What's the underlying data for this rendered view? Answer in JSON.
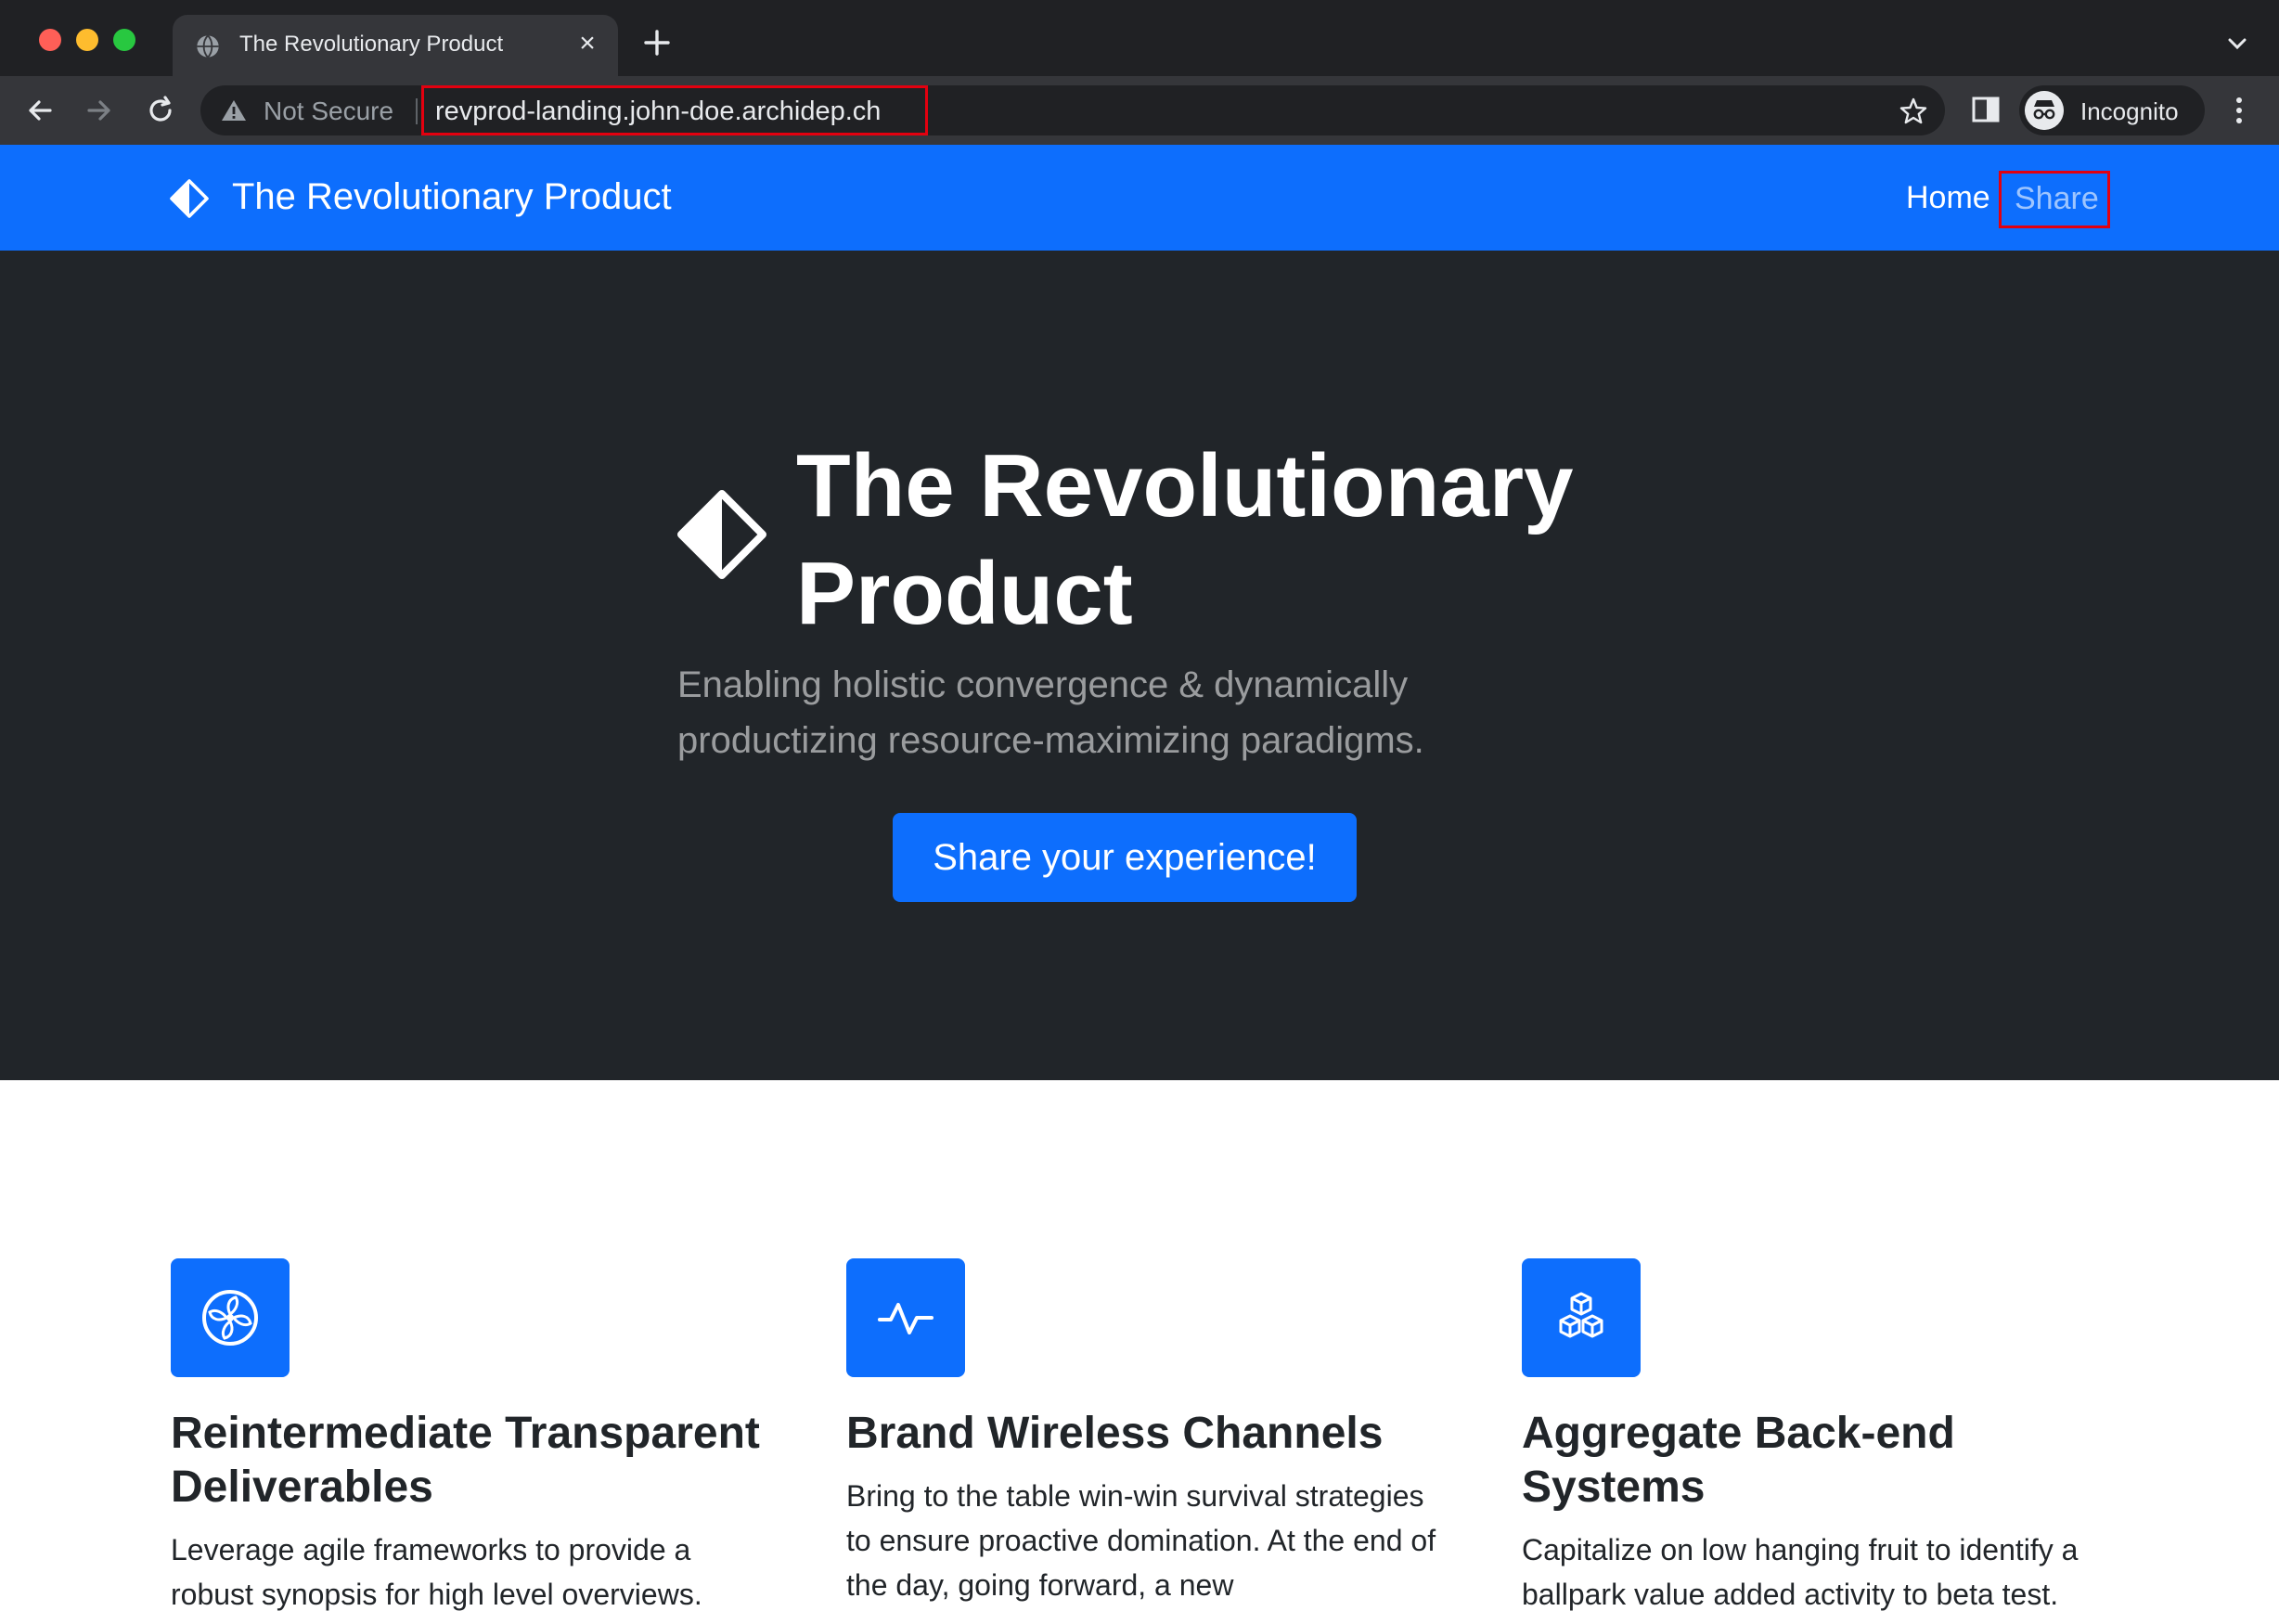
{
  "browser": {
    "tab_title": "The Revolutionary Product",
    "security_label": "Not Secure",
    "url": "revprod-landing.john-doe.archidep.ch",
    "profile_label": "Incognito"
  },
  "navbar": {
    "brand": "The Revolutionary Product",
    "links": [
      {
        "label": "Home"
      },
      {
        "label": "Share"
      }
    ]
  },
  "hero": {
    "title": "The Revolutionary Product",
    "lead": "Enabling holistic convergence & dynamically productizing resource-maximizing paradigms.",
    "cta_label": "Share your experience!"
  },
  "features": [
    {
      "icon": "fan-icon",
      "title": "Reintermediate Transparent Deliverables",
      "text": "Leverage agile frameworks to provide a robust synopsis for high level overviews."
    },
    {
      "icon": "pulse-icon",
      "title": "Brand Wireless Channels",
      "text": "Bring to the table win-win survival strategies to ensure proactive domination. At the end of the day, going forward, a new"
    },
    {
      "icon": "boxes-icon",
      "title": "Aggregate Back-end Systems",
      "text": "Capitalize on low hanging fruit to identify a ballpark value added activity to beta test."
    }
  ],
  "colors": {
    "primary": "#0d6efd",
    "hero_bg": "#212529",
    "highlight_box": "#e3000f"
  }
}
